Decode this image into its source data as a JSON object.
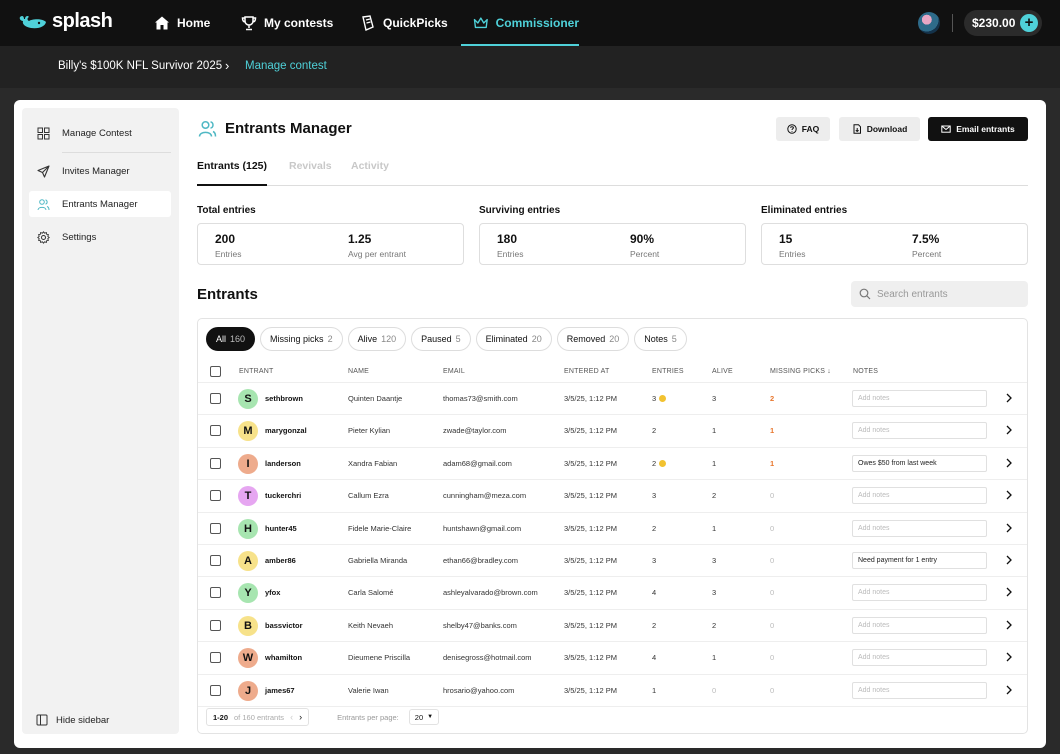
{
  "nav": {
    "logo_text": "splash",
    "items": [
      {
        "label": "Home",
        "icon": "home-icon"
      },
      {
        "label": "My contests",
        "icon": "trophy-icon"
      },
      {
        "label": "QuickPicks",
        "icon": "quickpicks-icon"
      },
      {
        "label": "Commissioner",
        "icon": "crown-icon",
        "active": true
      }
    ],
    "balance": "$230.00",
    "accent_color": "#4fd1d9"
  },
  "breadcrumb": {
    "contest": "Billy's $100K NFL Survivor 2025",
    "separator": "›",
    "current": "Manage contest"
  },
  "sidebar": {
    "items": [
      {
        "label": "Manage Contest",
        "icon": "grid-icon"
      },
      {
        "label": "Invites Manager",
        "icon": "send-icon"
      },
      {
        "label": "Entrants Manager",
        "icon": "users-icon",
        "active": true
      },
      {
        "label": "Settings",
        "icon": "gear-icon"
      }
    ],
    "hide_label": "Hide sidebar"
  },
  "header": {
    "title": "Entrants Manager",
    "faq": "FAQ",
    "download": "Download",
    "email": "Email entrants"
  },
  "tabs": [
    "Entrants (125)",
    "Revivals",
    "Activity"
  ],
  "stats": [
    {
      "title": "Total entries",
      "v1": "200",
      "l1": "Entries",
      "v2": "1.25",
      "l2": "Avg per entrant"
    },
    {
      "title": "Surviving entries",
      "v1": "180",
      "l1": "Entries",
      "v2": "90%",
      "l2": "Percent"
    },
    {
      "title": "Eliminated entries",
      "v1": "15",
      "l1": "Entries",
      "v2": "7.5%",
      "l2": "Percent"
    }
  ],
  "entrants": {
    "title": "Entrants",
    "search_placeholder": "Search entrants",
    "filters": [
      {
        "label": "All",
        "count": "160",
        "active": true
      },
      {
        "label": "Missing picks",
        "count": "2"
      },
      {
        "label": "Alive",
        "count": "120"
      },
      {
        "label": "Paused",
        "count": "5"
      },
      {
        "label": "Eliminated",
        "count": "20"
      },
      {
        "label": "Removed",
        "count": "20"
      },
      {
        "label": "Notes",
        "count": "5"
      }
    ],
    "columns": [
      "ENTRANT",
      "NAME",
      "EMAIL",
      "ENTERED AT",
      "ENTRIES",
      "ALIVE",
      "MISSING PICKS ↓",
      "NOTES"
    ],
    "note_placeholder": "Add notes",
    "rows": [
      {
        "letter": "S",
        "avatar_color": "#a7e5b0",
        "username": "sethbrown",
        "name": "Quinten Daantje",
        "email": "thomas73@smith.com",
        "entered": "3/5/25, 1:12 PM",
        "entries": "3",
        "coin": true,
        "alive": "3",
        "missing": "2",
        "note": ""
      },
      {
        "letter": "M",
        "avatar_color": "#f7e28a",
        "username": "marygonzal",
        "name": "Pieter Kylian",
        "email": "zwade@taylor.com",
        "entered": "3/5/25, 1:12 PM",
        "entries": "2",
        "coin": false,
        "alive": "1",
        "missing": "1",
        "note": ""
      },
      {
        "letter": "I",
        "avatar_color": "#eeab8c",
        "username": "landerson",
        "name": "Xandra Fabian",
        "email": "adam68@gmail.com",
        "entered": "3/5/25, 1:12 PM",
        "entries": "2",
        "coin": true,
        "alive": "1",
        "missing": "1",
        "note": "Owes $50 from last week"
      },
      {
        "letter": "T",
        "avatar_color": "#e6a6f1",
        "username": "tuckerchri",
        "name": "Callum Ezra",
        "email": "cunningham@meza.com",
        "entered": "3/5/25, 1:12 PM",
        "entries": "3",
        "coin": false,
        "alive": "2",
        "missing": "0",
        "note": ""
      },
      {
        "letter": "H",
        "avatar_color": "#a7e5b0",
        "username": "hunter45",
        "name": "Fidele Marie-Claire",
        "email": "huntshawn@gmail.com",
        "entered": "3/5/25, 1:12 PM",
        "entries": "2",
        "coin": false,
        "alive": "1",
        "missing": "0",
        "note": ""
      },
      {
        "letter": "A",
        "avatar_color": "#f7e28a",
        "username": "amber86",
        "name": "Gabriella Miranda",
        "email": "ethan66@bradley.com",
        "entered": "3/5/25, 1:12 PM",
        "entries": "3",
        "coin": false,
        "alive": "3",
        "missing": "0",
        "note": "Need payment for 1 entry"
      },
      {
        "letter": "Y",
        "avatar_color": "#a7e5b0",
        "username": "yfox",
        "name": "Carla Salomé",
        "email": "ashleyalvarado@brown.com",
        "entered": "3/5/25, 1:12 PM",
        "entries": "4",
        "coin": false,
        "alive": "3",
        "missing": "0",
        "note": ""
      },
      {
        "letter": "B",
        "avatar_color": "#f7e28a",
        "username": "bassvictor",
        "name": "Keith Nevaeh",
        "email": "shelby47@banks.com",
        "entered": "3/5/25, 1:12 PM",
        "entries": "2",
        "coin": false,
        "alive": "2",
        "missing": "0",
        "note": ""
      },
      {
        "letter": "W",
        "avatar_color": "#eeab8c",
        "username": "whamilton",
        "name": "Dieumene Priscilla",
        "email": "denisegross@hotmail.com",
        "entered": "3/5/25, 1:12 PM",
        "entries": "4",
        "coin": false,
        "alive": "1",
        "missing": "0",
        "note": ""
      },
      {
        "letter": "J",
        "avatar_color": "#eeab8c",
        "username": "james67",
        "name": "Valerie Iwan",
        "email": "hrosario@yahoo.com",
        "entered": "3/5/25, 1:12 PM",
        "entries": "1",
        "coin": false,
        "alive": "0",
        "missing": "0",
        "note": ""
      }
    ],
    "pagination": {
      "range": "1-20",
      "of_text": "of 160 entrants",
      "per_page_label": "Entrants per page:",
      "per_page": "20"
    }
  }
}
